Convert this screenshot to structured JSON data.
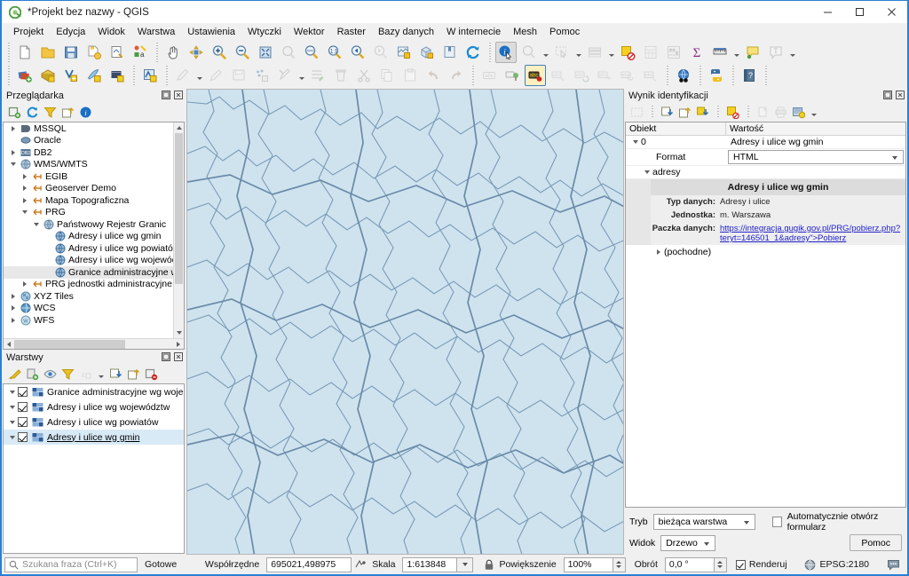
{
  "window": {
    "title": "*Projekt bez nazwy - QGIS",
    "logo_icon": "qgis-logo-icon",
    "minimize_label": "–",
    "maximize_label": "❑",
    "close_label": "✕"
  },
  "menubar": {
    "items": [
      {
        "label": "Projekt"
      },
      {
        "label": "Edycja"
      },
      {
        "label": "Widok"
      },
      {
        "label": "Warstwa"
      },
      {
        "label": "Ustawienia"
      },
      {
        "label": "Wtyczki"
      },
      {
        "label": "Wektor"
      },
      {
        "label": "Raster"
      },
      {
        "label": "Bazy danych"
      },
      {
        "label": "W internecie"
      },
      {
        "label": "Mesh"
      },
      {
        "label": "Pomoc"
      }
    ]
  },
  "toolbar_row1": [
    {
      "icon": "new-project-icon"
    },
    {
      "icon": "open-project-icon"
    },
    {
      "icon": "save-project-icon"
    },
    {
      "icon": "save-project-as-icon"
    },
    {
      "icon": "new-print-layout-icon"
    },
    {
      "icon": "style-manager-icon"
    },
    {
      "sep": true
    },
    {
      "icon": "pan-map-icon"
    },
    {
      "icon": "pan-to-selection-icon"
    },
    {
      "icon": "zoom-in-icon"
    },
    {
      "icon": "zoom-out-icon"
    },
    {
      "icon": "zoom-full-icon"
    },
    {
      "icon": "zoom-selection-icon",
      "disabled": true
    },
    {
      "icon": "zoom-layer-icon"
    },
    {
      "icon": "zoom-native-icon"
    },
    {
      "icon": "zoom-last-icon"
    },
    {
      "icon": "zoom-next-icon",
      "disabled": true
    },
    {
      "icon": "new-map-view-icon"
    },
    {
      "icon": "new-3d-map-view-icon"
    },
    {
      "icon": "new-bookmark-icon"
    },
    {
      "icon": "refresh-icon"
    },
    {
      "sep": true
    },
    {
      "icon": "identify-features-icon",
      "active": true
    },
    {
      "icon": "measure-icon",
      "disabled": true,
      "arrow": true
    },
    {
      "icon": "select-features-icon",
      "disabled": true,
      "arrow": true
    },
    {
      "icon": "open-attribute-table-icon",
      "disabled": true,
      "arrow": true
    },
    {
      "icon": "deselect-features-icon"
    },
    {
      "icon": "open-field-calculator-icon",
      "disabled": true
    },
    {
      "icon": "statistical-summary-icon",
      "disabled": true
    },
    {
      "icon": "sum-icon"
    },
    {
      "icon": "measure-line-icon",
      "arrow": true
    },
    {
      "icon": "map-tips-icon"
    },
    {
      "icon": "text-annotation-icon",
      "disabled": true,
      "arrow": true
    }
  ],
  "toolbar_row2": [
    {
      "icon": "add-raster-layer-icon"
    },
    {
      "icon": "add-wms-layer-icon"
    },
    {
      "icon": "add-vector-layer-icon"
    },
    {
      "icon": "add-delimited-text-layer-icon"
    },
    {
      "icon": "add-mesh-layer-icon"
    },
    {
      "sep": true
    },
    {
      "icon": "toggle-editing-icon"
    },
    {
      "sep": true
    },
    {
      "icon": "current-edits-icon",
      "disabled": true,
      "arrow": true
    },
    {
      "icon": "add-feature-icon",
      "disabled": true
    },
    {
      "icon": "save-layer-edits-icon",
      "disabled": true
    },
    {
      "icon": "vertex-tool-icon",
      "disabled": true
    },
    {
      "icon": "modify-attributes-icon",
      "disabled": true,
      "arrow": true
    },
    {
      "icon": "multi-edit-icon",
      "disabled": true
    },
    {
      "icon": "delete-selected-icon",
      "disabled": true
    },
    {
      "icon": "cut-features-icon",
      "disabled": true
    },
    {
      "icon": "copy-features-icon",
      "disabled": true
    },
    {
      "icon": "paste-features-icon",
      "disabled": true
    },
    {
      "icon": "undo-icon",
      "disabled": true
    },
    {
      "icon": "redo-icon",
      "disabled": true
    },
    {
      "sep": true
    },
    {
      "icon": "label-layer-icon",
      "disabled": true
    },
    {
      "icon": "pin-labels-icon",
      "disabled": true
    },
    {
      "icon": "highlight-labels-icon",
      "highlight": true
    },
    {
      "icon": "move-label-icon",
      "disabled": true
    },
    {
      "icon": "rotate-label-icon",
      "disabled": true
    },
    {
      "icon": "change-label-icon",
      "disabled": true
    },
    {
      "icon": "label-properties-icon",
      "disabled": true
    },
    {
      "icon": "label-callout-icon",
      "disabled": true
    },
    {
      "sep": true
    },
    {
      "icon": "metasearch-icon"
    },
    {
      "sep": true
    },
    {
      "icon": "python-console-icon"
    },
    {
      "sep": true
    },
    {
      "icon": "help-contents-icon"
    }
  ],
  "browser_panel": {
    "title": "Przeglądarka",
    "float_icon": "float-panel-icon",
    "close_icon": "close-panel-icon",
    "toolbar": [
      {
        "icon": "add-layer-icon"
      },
      {
        "icon": "refresh-icon"
      },
      {
        "icon": "filter-icon"
      },
      {
        "icon": "collapse-all-icon"
      },
      {
        "icon": "properties-info-icon"
      }
    ],
    "tree": [
      {
        "depth": 0,
        "twist": "closed",
        "icon": "mssql-icon",
        "label": "MSSQL"
      },
      {
        "depth": 0,
        "twist": "none",
        "icon": "oracle-icon",
        "label": "Oracle"
      },
      {
        "depth": 0,
        "twist": "closed",
        "icon": "db2-icon",
        "label": "DB2"
      },
      {
        "depth": 0,
        "twist": "open",
        "icon": "wms-icon",
        "label": "WMS/WMTS"
      },
      {
        "depth": 1,
        "twist": "closed",
        "icon": "wms-connection-icon",
        "label": "EGIB"
      },
      {
        "depth": 1,
        "twist": "closed",
        "icon": "wms-connection-icon",
        "label": "Geoserver Demo"
      },
      {
        "depth": 1,
        "twist": "closed",
        "icon": "wms-connection-icon",
        "label": "Mapa Topograficzna"
      },
      {
        "depth": 1,
        "twist": "open",
        "icon": "wms-connection-icon",
        "label": "PRG"
      },
      {
        "depth": 2,
        "twist": "open",
        "icon": "wms-icon",
        "label": "Państwowy Rejestr Granic"
      },
      {
        "depth": 3,
        "twist": "none",
        "icon": "wms-layer-icon",
        "label": "Adresy i ulice wg gmin"
      },
      {
        "depth": 3,
        "twist": "none",
        "icon": "wms-layer-icon",
        "label": "Adresy i ulice wg powiatów"
      },
      {
        "depth": 3,
        "twist": "none",
        "icon": "wms-layer-icon",
        "label": "Adresy i ulice wg województw"
      },
      {
        "depth": 3,
        "twist": "none",
        "icon": "wms-layer-icon",
        "label": "Granice administracyjne wg",
        "selected": true
      },
      {
        "depth": 1,
        "twist": "closed",
        "icon": "wms-connection-icon",
        "label": "PRG jednostki administracyjne"
      },
      {
        "depth": 0,
        "twist": "closed",
        "icon": "xyz-tiles-icon",
        "label": "XYZ Tiles"
      },
      {
        "depth": 0,
        "twist": "closed",
        "icon": "wcs-icon",
        "label": "WCS"
      },
      {
        "depth": 0,
        "twist": "closed",
        "icon": "wfs-icon",
        "label": "WFS"
      }
    ]
  },
  "layers_panel": {
    "title": "Warstwy",
    "float_icon": "float-panel-icon",
    "close_icon": "close-panel-icon",
    "toolbar": [
      {
        "icon": "open-layer-styling-icon"
      },
      {
        "icon": "add-group-icon"
      },
      {
        "icon": "manage-map-themes-icon"
      },
      {
        "icon": "filter-legend-icon"
      },
      {
        "icon": "filter-legend-expression-icon",
        "disabled": true,
        "arrow": true
      },
      {
        "icon": "expand-all-icon"
      },
      {
        "icon": "collapse-all-icon"
      },
      {
        "icon": "remove-layer-icon"
      }
    ],
    "layers": [
      {
        "checked": true,
        "icon": "wms-layer-icon",
        "label": "Granice administracyjne wg woje...",
        "selected": false,
        "underline": false
      },
      {
        "checked": true,
        "icon": "wms-layer-icon",
        "label": "Adresy i ulice wg województw",
        "selected": false,
        "underline": false
      },
      {
        "checked": true,
        "icon": "wms-layer-icon",
        "label": "Adresy i ulice wg powiatów",
        "selected": false,
        "underline": false
      },
      {
        "checked": true,
        "icon": "wms-layer-icon",
        "label": "Adresy i ulice wg gmin",
        "selected": true,
        "underline": true
      }
    ]
  },
  "map": {
    "background_color": "#cfe3ef",
    "boundary_color": "#7a9ab5"
  },
  "identify_panel": {
    "title": "Wynik identyfikacji",
    "float_icon": "float-panel-icon",
    "close_icon": "close-panel-icon",
    "toolbar": [
      {
        "icon": "expand-new-icon",
        "disabled": true
      },
      {
        "icon": "expand-all-icon"
      },
      {
        "icon": "collapse-all-icon"
      },
      {
        "icon": "expand-new-tree-icon"
      },
      {
        "icon": "clear-results-icon"
      },
      {
        "icon": "copy-icon",
        "disabled": true
      },
      {
        "icon": "print-icon",
        "disabled": true
      },
      {
        "icon": "identify-settings-icon",
        "arrow": true
      }
    ],
    "columns": {
      "object": "Obiekt",
      "value": "Wartość"
    },
    "rows": [
      {
        "type": "node",
        "depth": 0,
        "twist": "open",
        "key": "0",
        "value": "Adresy i ulice wg gmin"
      },
      {
        "type": "combo",
        "depth": 1,
        "key": "Format",
        "value": "HTML"
      },
      {
        "type": "node",
        "depth": 1,
        "twist": "open",
        "key": "adresy",
        "value": ""
      }
    ],
    "html_result": {
      "title": "Adresy i ulice wg gmin",
      "fields": [
        {
          "key": "Typ danych:",
          "value": "Adresy i ulice",
          "link": false
        },
        {
          "key": "Jednostka:",
          "value": "m. Warszawa",
          "link": false
        },
        {
          "key": "Paczka danych:",
          "value": "https://integracja.gugik.gov.pl/PRG/pobierz.php?teryt=146501_1&adresy\">Pobierz",
          "link": true,
          "link_text": "https://integracja.gugik.gov.pl/PRG/pobierz.php?teryt=146501_1&adresy",
          "suffix": "\">Pobierz"
        }
      ]
    },
    "derived_row": {
      "twist": "closed",
      "label": "(pochodne)"
    },
    "footer": {
      "mode_label": "Tryb",
      "mode_value": "bieżąca warstwa",
      "auto_open_form_label": "Automatycznie otwórz formularz",
      "auto_open_form_checked": false,
      "view_label": "Widok",
      "view_value": "Drzewo",
      "help_button": "Pomoc"
    }
  },
  "statusbar": {
    "search_placeholder": "Szukana fraza (Ctrl+K)",
    "search_icon": "search-icon",
    "status_text": "Gotowe",
    "coordinate_label": "Współrzędne",
    "coordinate_value": "695021,498975",
    "coordinate_toggle_icon": "toggle-extents-icon",
    "scale_label": "Skala",
    "scale_value": "1:613848",
    "lock_icon": "lock-scale-icon",
    "magnifier_label": "Powiększenie",
    "magnifier_value": "100%",
    "rotation_label": "Obrót",
    "rotation_value": "0,0 °",
    "render_label": "Renderuj",
    "render_checked": true,
    "crs_icon": "crs-icon",
    "crs_value": "EPSG:2180",
    "messages_icon": "messages-icon"
  }
}
